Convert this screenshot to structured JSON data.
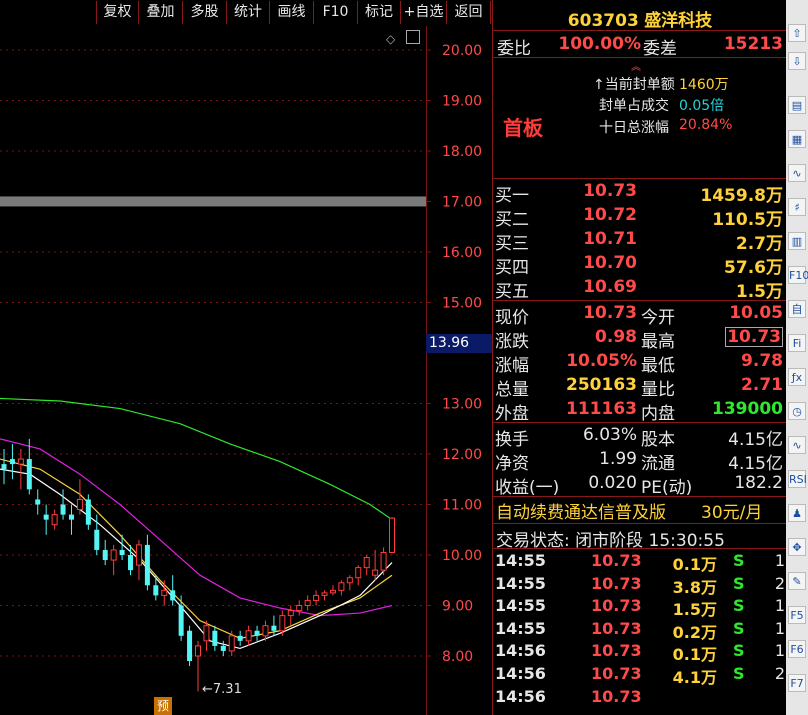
{
  "toolbar": {
    "buttons": [
      "复权",
      "叠加",
      "多股",
      "统计",
      "画线",
      "F10",
      "标记",
      "+自选",
      "返回"
    ]
  },
  "chart": {
    "y_labels": [
      "20.00",
      "19.00",
      "18.00",
      "17.00",
      "16.00",
      "15.00",
      "13.00",
      "12.00",
      "11.00",
      "10.00",
      "9.00",
      "8.00"
    ],
    "current_price_tag": "13.96",
    "low_marker": "7.31",
    "pre_marker": "预",
    "colors": {
      "up": "#ff3b3b",
      "down": "#54f5f5",
      "grid": "#7a1414",
      "ma5": "#ffffff",
      "ma10": "#ffd23a",
      "ma20": "#e020e0",
      "ma60": "#2ee82e"
    }
  },
  "chart_data": {
    "type": "candlestick",
    "ylim": [
      7.7,
      20.5
    ],
    "ticks": [
      20,
      19,
      18,
      17,
      16,
      15,
      13,
      12,
      11,
      10,
      9,
      8
    ],
    "candles": [
      {
        "o": 11.8,
        "h": 12.1,
        "l": 11.4,
        "c": 11.7
      },
      {
        "o": 11.9,
        "h": 12.2,
        "l": 11.5,
        "c": 11.8
      },
      {
        "o": 11.8,
        "h": 12.1,
        "l": 11.3,
        "c": 11.9
      },
      {
        "o": 11.9,
        "h": 12.3,
        "l": 11.2,
        "c": 11.3
      },
      {
        "o": 11.1,
        "h": 11.3,
        "l": 10.8,
        "c": 11.0
      },
      {
        "o": 10.8,
        "h": 11.0,
        "l": 10.4,
        "c": 10.7
      },
      {
        "o": 10.6,
        "h": 10.9,
        "l": 10.5,
        "c": 10.8
      },
      {
        "o": 11.0,
        "h": 11.3,
        "l": 10.7,
        "c": 10.8
      },
      {
        "o": 10.8,
        "h": 11.0,
        "l": 10.4,
        "c": 10.7
      },
      {
        "o": 10.9,
        "h": 11.5,
        "l": 10.8,
        "c": 11.1
      },
      {
        "o": 11.1,
        "h": 11.2,
        "l": 10.5,
        "c": 10.6
      },
      {
        "o": 10.5,
        "h": 10.8,
        "l": 10.0,
        "c": 10.1
      },
      {
        "o": 10.1,
        "h": 10.3,
        "l": 9.8,
        "c": 9.9
      },
      {
        "o": 9.9,
        "h": 10.2,
        "l": 9.6,
        "c": 10.1
      },
      {
        "o": 10.1,
        "h": 10.4,
        "l": 9.9,
        "c": 10.0
      },
      {
        "o": 10.0,
        "h": 10.2,
        "l": 9.6,
        "c": 9.7
      },
      {
        "o": 9.8,
        "h": 10.3,
        "l": 9.5,
        "c": 10.2
      },
      {
        "o": 10.2,
        "h": 10.4,
        "l": 9.3,
        "c": 9.4
      },
      {
        "o": 9.4,
        "h": 9.6,
        "l": 9.1,
        "c": 9.2
      },
      {
        "o": 9.2,
        "h": 9.5,
        "l": 9.0,
        "c": 9.3
      },
      {
        "o": 9.3,
        "h": 9.6,
        "l": 9.0,
        "c": 9.1
      },
      {
        "o": 9.0,
        "h": 9.2,
        "l": 8.3,
        "c": 8.4
      },
      {
        "o": 8.5,
        "h": 8.6,
        "l": 7.8,
        "c": 7.9
      },
      {
        "o": 8.0,
        "h": 8.3,
        "l": 7.3,
        "c": 8.2
      },
      {
        "o": 8.3,
        "h": 8.7,
        "l": 8.1,
        "c": 8.6
      },
      {
        "o": 8.5,
        "h": 8.6,
        "l": 8.1,
        "c": 8.2
      },
      {
        "o": 8.2,
        "h": 8.3,
        "l": 8.0,
        "c": 8.1
      },
      {
        "o": 8.1,
        "h": 8.5,
        "l": 8.0,
        "c": 8.4
      },
      {
        "o": 8.4,
        "h": 8.5,
        "l": 8.2,
        "c": 8.3
      },
      {
        "o": 8.3,
        "h": 8.6,
        "l": 8.2,
        "c": 8.5
      },
      {
        "o": 8.5,
        "h": 8.6,
        "l": 8.3,
        "c": 8.4
      },
      {
        "o": 8.4,
        "h": 8.7,
        "l": 8.3,
        "c": 8.6
      },
      {
        "o": 8.6,
        "h": 8.8,
        "l": 8.4,
        "c": 8.5
      },
      {
        "o": 8.5,
        "h": 8.9,
        "l": 8.4,
        "c": 8.8
      },
      {
        "o": 8.8,
        "h": 9.0,
        "l": 8.6,
        "c": 8.9
      },
      {
        "o": 8.9,
        "h": 9.1,
        "l": 8.8,
        "c": 9.0
      },
      {
        "o": 9.0,
        "h": 9.2,
        "l": 8.9,
        "c": 9.1
      },
      {
        "o": 9.1,
        "h": 9.3,
        "l": 9.0,
        "c": 9.2
      },
      {
        "o": 9.2,
        "h": 9.3,
        "l": 9.1,
        "c": 9.25
      },
      {
        "o": 9.25,
        "h": 9.4,
        "l": 9.2,
        "c": 9.3
      },
      {
        "o": 9.3,
        "h": 9.5,
        "l": 9.2,
        "c": 9.45
      },
      {
        "o": 9.45,
        "h": 9.6,
        "l": 9.3,
        "c": 9.55
      },
      {
        "o": 9.55,
        "h": 9.8,
        "l": 9.4,
        "c": 9.75
      },
      {
        "o": 9.75,
        "h": 10.0,
        "l": 9.6,
        "c": 9.95
      },
      {
        "o": 9.6,
        "h": 10.1,
        "l": 9.5,
        "c": 9.7
      },
      {
        "o": 9.7,
        "h": 10.15,
        "l": 9.6,
        "c": 10.05
      },
      {
        "o": 10.05,
        "h": 10.75,
        "l": 10.05,
        "c": 10.73
      }
    ],
    "ma_green": [
      [
        0,
        13.1
      ],
      [
        60,
        13.05
      ],
      [
        120,
        12.9
      ],
      [
        180,
        12.6
      ],
      [
        230,
        12.2
      ],
      [
        280,
        11.85
      ],
      [
        330,
        11.4
      ],
      [
        370,
        11.0
      ],
      [
        392,
        10.7
      ]
    ],
    "ma_magenta": [
      [
        0,
        12.3
      ],
      [
        40,
        12.1
      ],
      [
        80,
        11.6
      ],
      [
        120,
        11.0
      ],
      [
        160,
        10.3
      ],
      [
        200,
        9.6
      ],
      [
        240,
        9.15
      ],
      [
        280,
        8.95
      ],
      [
        320,
        8.8
      ],
      [
        360,
        8.85
      ],
      [
        392,
        9.0
      ]
    ],
    "ma_yellow": [
      [
        0,
        11.9
      ],
      [
        40,
        11.7
      ],
      [
        80,
        11.2
      ],
      [
        120,
        10.4
      ],
      [
        160,
        9.5
      ],
      [
        200,
        8.7
      ],
      [
        240,
        8.35
      ],
      [
        280,
        8.5
      ],
      [
        320,
        8.85
      ],
      [
        360,
        9.15
      ],
      [
        392,
        9.6
      ]
    ],
    "ma_white": [
      [
        0,
        11.7
      ],
      [
        30,
        11.6
      ],
      [
        60,
        11.2
      ],
      [
        100,
        10.6
      ],
      [
        140,
        9.9
      ],
      [
        180,
        9.0
      ],
      [
        210,
        8.3
      ],
      [
        240,
        8.15
      ],
      [
        280,
        8.45
      ],
      [
        320,
        8.8
      ],
      [
        360,
        9.2
      ],
      [
        392,
        9.85
      ]
    ]
  },
  "panel": {
    "stock_code": "603703",
    "stock_name": "盛洋科技",
    "weibi_label": "委比",
    "weibi_value": "100.00%",
    "weicha_label": "委差",
    "weicha_value": "15213",
    "board": "首板",
    "seal_amount_label": "当前封单额",
    "seal_amount_value": "1460万",
    "seal_ratio_label": "封单占成交",
    "seal_ratio_value": "0.05倍",
    "ten_day_label": "十日总涨幅",
    "ten_day_value": "20.84%",
    "bids": [
      {
        "label": "买一",
        "price": "10.73",
        "vol": "1459.8万"
      },
      {
        "label": "买二",
        "price": "10.72",
        "vol": "110.5万"
      },
      {
        "label": "买三",
        "price": "10.71",
        "vol": "2.7万"
      },
      {
        "label": "买四",
        "price": "10.70",
        "vol": "57.6万"
      },
      {
        "label": "买五",
        "price": "10.69",
        "vol": "1.5万"
      }
    ],
    "quote": [
      {
        "l1": "现价",
        "v1": "10.73",
        "l2": "今开",
        "v2": "10.05"
      },
      {
        "l1": "涨跌",
        "v1": "0.98",
        "l2": "最高",
        "v2": "10.73"
      },
      {
        "l1": "涨幅",
        "v1": "10.05%",
        "l2": "最低",
        "v2": "9.78"
      },
      {
        "l1": "总量",
        "v1": "250163",
        "l2": "量比",
        "v2": "2.71"
      },
      {
        "l1": "外盘",
        "v1": "111163",
        "l2": "内盘",
        "v2": "139000"
      }
    ],
    "stats": [
      {
        "l1": "换手",
        "v1": "6.03%",
        "l2": "股本",
        "v2": "4.15亿"
      },
      {
        "l1": "净资",
        "v1": "1.99",
        "l2": "流通",
        "v2": "4.15亿"
      },
      {
        "l1": "收益(一)",
        "v1": "0.020",
        "l2": "PE(动)",
        "v2": "182.2"
      }
    ],
    "ad_text": "自动续费通达信普及版",
    "ad_price": "30元/月",
    "status_text": "交易状态: 闭市阶段 15:30:55",
    "ticks": [
      {
        "time": "14:55",
        "price": "10.73",
        "vol": "0.1万",
        "side": "S",
        "n": "1"
      },
      {
        "time": "14:55",
        "price": "10.73",
        "vol": "3.8万",
        "side": "S",
        "n": "2"
      },
      {
        "time": "14:55",
        "price": "10.73",
        "vol": "1.5万",
        "side": "S",
        "n": "1"
      },
      {
        "time": "14:55",
        "price": "10.73",
        "vol": "0.2万",
        "side": "S",
        "n": "1"
      },
      {
        "time": "14:56",
        "price": "10.73",
        "vol": "0.1万",
        "side": "S",
        "n": "1"
      },
      {
        "time": "14:56",
        "price": "10.73",
        "vol": "4.1万",
        "side": "S",
        "n": "2"
      },
      {
        "time": "14:56",
        "price": "10.73",
        "vol": "",
        "side": "",
        "n": ""
      }
    ]
  },
  "sidebar": {
    "icons": [
      "arrow-up-icon",
      "arrow-down-icon",
      "grid-icon",
      "chart-icon",
      "line-chart-icon",
      "candles-icon",
      "table-icon",
      "f10-icon",
      "book-icon",
      "f10-small-icon",
      "function-icon",
      "clock-icon",
      "wave-icon",
      "rsi-icon",
      "people-icon",
      "move-icon",
      "pen-icon",
      "f5-icon",
      "f6-icon",
      "f7-icon"
    ],
    "labels": [
      "⇧",
      "⇩",
      "▤",
      "▦",
      "∿",
      "♯",
      "▥",
      "F10",
      "自",
      "Fi",
      "ƒx",
      "◷",
      "∿",
      "RSI",
      "♟",
      "✥",
      "✎",
      "F5",
      "F6",
      "F7"
    ]
  }
}
